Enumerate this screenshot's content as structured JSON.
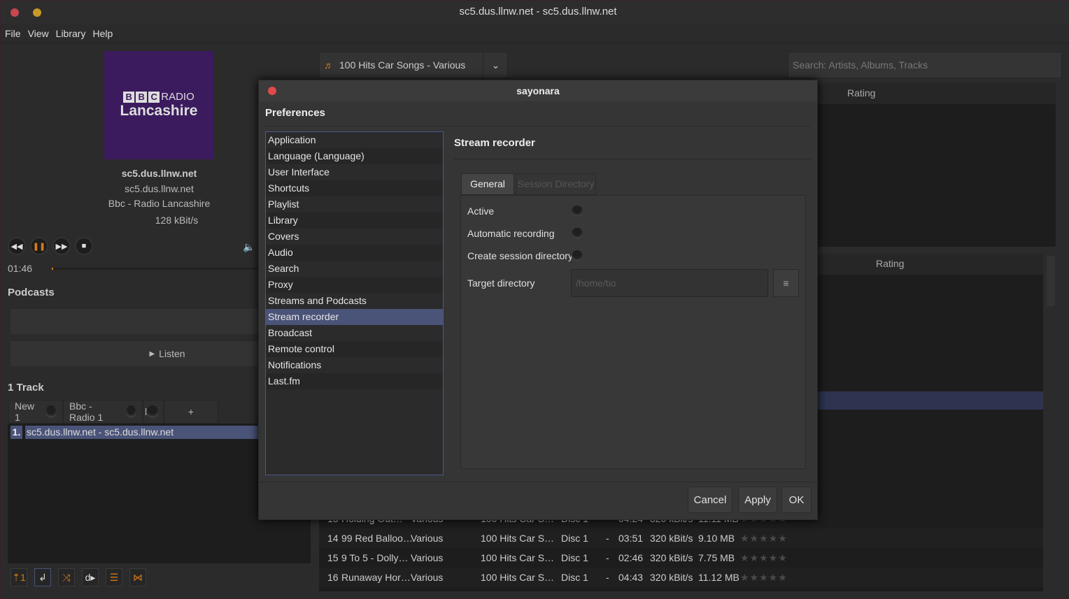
{
  "window": {
    "title": "sc5.dus.llnw.net - sc5.dus.llnw.net"
  },
  "menu": [
    "File",
    "View",
    "Library",
    "Help"
  ],
  "cover": {
    "brand": "RADIO",
    "letters": [
      "B",
      "B",
      "C"
    ],
    "station": "Lancashire"
  },
  "now_playing": {
    "title": "sc5.dus.llnw.net",
    "artist": "sc5.dus.llnw.net",
    "album": "Bbc - Radio Lancashire",
    "bitrate": "128 kBit/s",
    "time": "01:46",
    "progress": 0.0
  },
  "podcasts": {
    "title": "Podcasts",
    "listen_label": "Listen"
  },
  "playlist": {
    "count_label": "1 Track",
    "tabs": [
      "New 1",
      "Bbc - Radio 1",
      "li"
    ],
    "add_label": "+",
    "items": [
      {
        "num": "1.",
        "text": "sc5.dus.llnw.net - sc5.dus.llnw.net"
      }
    ]
  },
  "library": {
    "album_combo": "100 Hits Car Songs - Various",
    "search_placeholder": "Search: Artists, Albums, Tracks",
    "rating_header": "Rating",
    "tracks": [
      {
        "num": "13",
        "title": "Holding Out…",
        "artist": "Various",
        "album": "100 Hits Car S…",
        "disc": "Disc 1",
        "dash": "-",
        "length": "04:24",
        "bitrate": "320 kBit/s",
        "size": "11.11 MB",
        "rating": 0
      },
      {
        "num": "14",
        "title": "99 Red Balloo…",
        "artist": "Various",
        "album": "100 Hits Car S…",
        "disc": "Disc 1",
        "dash": "-",
        "length": "03:51",
        "bitrate": "320 kBit/s",
        "size": "9.10 MB",
        "rating": 0
      },
      {
        "num": "15",
        "title": "9 To 5 - Dolly…",
        "artist": "Various",
        "album": "100 Hits Car S…",
        "disc": "Disc 1",
        "dash": "-",
        "length": "02:46",
        "bitrate": "320 kBit/s",
        "size": "7.75 MB",
        "rating": 0
      },
      {
        "num": "16",
        "title": "Runaway Hor…",
        "artist": "Various",
        "album": "100 Hits Car S…",
        "disc": "Disc 1",
        "dash": "-",
        "length": "04:43",
        "bitrate": "320 kBit/s",
        "size": "11.12 MB",
        "rating": 0
      }
    ]
  },
  "dialog": {
    "title": "sayonara",
    "heading": "Preferences",
    "categories": [
      "Application",
      "Language (Language)",
      "User Interface",
      "Shortcuts",
      "Playlist",
      "Library",
      "Covers",
      "Audio",
      "Search",
      "Proxy",
      "Streams and Podcasts",
      "Stream recorder",
      "Broadcast",
      "Remote control",
      "Notifications",
      "Last.fm"
    ],
    "selected": "Stream recorder",
    "page_title": "Stream recorder",
    "tabs": [
      "General",
      "Session Directory"
    ],
    "options": [
      {
        "label": "Active",
        "checked": false
      },
      {
        "label": "Automatic recording",
        "checked": false
      },
      {
        "label": "Create session directory",
        "checked": false
      }
    ],
    "target_label": "Target directory",
    "target_placeholder": "/home/tio",
    "buttons": {
      "cancel": "Cancel",
      "apply": "Apply",
      "ok": "OK"
    }
  },
  "colors": {
    "accent": "#4a5378",
    "orange": "#d37a1a",
    "cover": "#3b1b5e"
  }
}
